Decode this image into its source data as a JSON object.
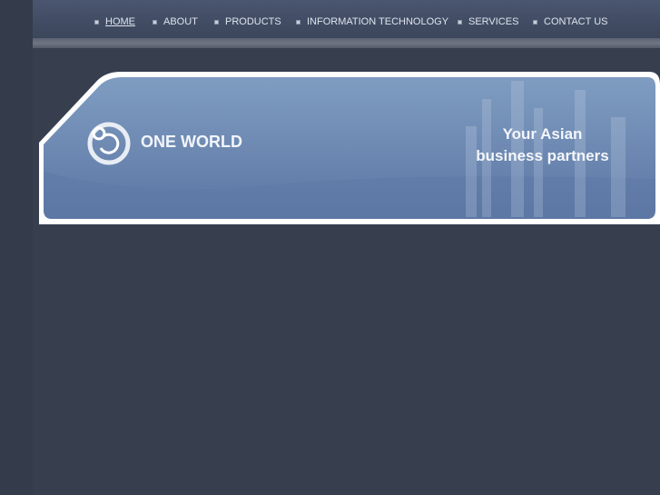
{
  "nav": [
    {
      "label": "HOME",
      "active": true
    },
    {
      "label": "ABOUT"
    },
    {
      "label": "PRODUCTS"
    },
    {
      "label": "INFORMATION TECHNOLOGY"
    },
    {
      "label": "SERVICES"
    },
    {
      "label": "CONTACT US"
    }
  ],
  "banner": {
    "brand": "ONE WORLD",
    "tagline_line1": "Your Asian",
    "tagline_line2": "business partners"
  }
}
